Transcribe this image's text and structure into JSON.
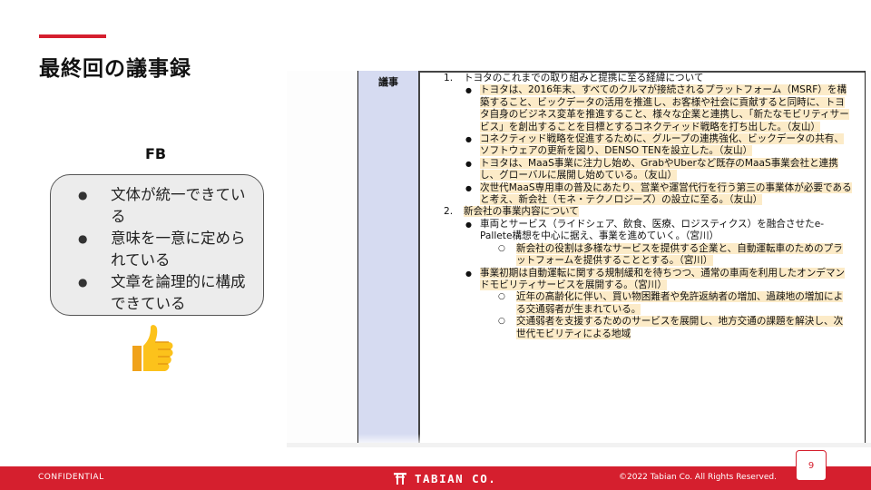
{
  "slide": {
    "title": "最終回の議事録",
    "page_number": "9"
  },
  "feedback": {
    "label": "FB",
    "items": [
      "文体が統一できている",
      "意味を一意に定められている",
      "文章を論理的に構成できている"
    ],
    "icon": "thumbs-up-icon"
  },
  "document": {
    "side_label": "議事",
    "sections": [
      {
        "number": "1.",
        "heading": "トヨタのこれまでの取り組みと提携に至る経緯について",
        "bullets": [
          {
            "text": "トヨタは、2016年末、すべてのクルマが接続されるプラットフォーム（MSRF）を構築すること、ビックデータの活用を推進し、お客様や社会に貢献すると同時に、トヨタ自身のビジネス変革を推進すること、様々な企業と連携し、「新たなモビリティサービス」を創出することを目標とするコネクティッド戦略を打ち出した。（友山）",
            "sub": []
          },
          {
            "text": "コネクティッド戦略を促進するために、グループの連携強化、ビックデータの共有、ソフトウェアの更新を図り、DENSO TENを設立した。（友山）",
            "sub": []
          },
          {
            "text": "トヨタは、MaaS事業に注力し始め、GrabやUberなど既存のMaaS事業会社と連携し、グローバルに展開し始めている。（友山）",
            "sub": []
          },
          {
            "text": "次世代MaaS専用車の普及にあたり、営業や運営代行を行う第三の事業体が必要であると考え、新会社（モネ・テクノロジーズ）の設立に至る。（友山）",
            "sub": []
          }
        ]
      },
      {
        "number": "2.",
        "heading": "新会社の事業内容について",
        "bullets": [
          {
            "text": "車両とサービス（ライドシェア、飲食、医療、ロジスティクス）を融合させたe-Pallete構想を中心に据え、事業を進めていく。（宮川）",
            "sub": [
              "新会社の役割は多様なサービスを提供する企業と、自動運転車のためのプラットフォームを提供することとする。（宮川）"
            ]
          },
          {
            "text": "事業初期は自動運転に関する規制緩和を待ちつつ、通常の車両を利用したオンデマンドモビリティサービスを展開する。（宮川）",
            "sub": [
              "近年の高齢化に伴い、買い物困難者や免許返納者の増加、過疎地の増加による交通弱者が生まれている。",
              "交通弱者を支援するためのサービスを展開し、地方交通の課題を解決し、次世代モビリティによる地域"
            ]
          }
        ]
      }
    ]
  },
  "footer": {
    "left": "CONFIDENTIAL",
    "brand": "TABIAN CO.",
    "right": "©2022 Tabian Co. All Rights Reserved."
  },
  "colors": {
    "accent": "#d51f2e",
    "highlight": "#fcebc8",
    "doc_side": "#d6dbf1",
    "fb_box": "#ececec"
  }
}
